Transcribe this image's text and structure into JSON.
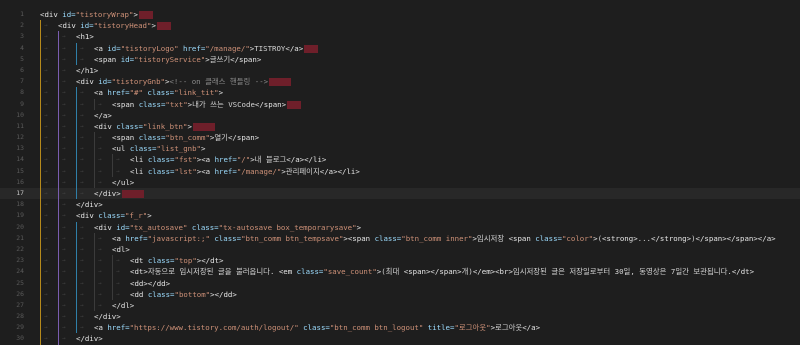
{
  "editor": {
    "lines": [
      {
        "n": "1",
        "indent": 0,
        "code": [
          [
            "tag",
            "<div "
          ],
          [
            "attr",
            "id="
          ],
          [
            "str",
            "\"tistoryWrap\""
          ],
          [
            "tag",
            ">"
          ]
        ],
        "trail": "short"
      },
      {
        "n": "2",
        "indent": 1,
        "code": [
          [
            "tag",
            "<div "
          ],
          [
            "attr",
            "id="
          ],
          [
            "str",
            "\"tistoryHead\""
          ],
          [
            "tag",
            ">"
          ]
        ],
        "trail": "short"
      },
      {
        "n": "3",
        "indent": 2,
        "code": [
          [
            "tag",
            "<h1>"
          ]
        ],
        "trail": ""
      },
      {
        "n": "4",
        "indent": 3,
        "code": [
          [
            "tag",
            "<a "
          ],
          [
            "attr",
            "id="
          ],
          [
            "str",
            "\"tistoryLogo\""
          ],
          [
            "attr",
            " href="
          ],
          [
            "str",
            "\"/manage/\""
          ],
          [
            "tag",
            ">"
          ],
          [
            "txt",
            "TISTROY"
          ],
          [
            "tag",
            "</a>"
          ]
        ],
        "trail": "short"
      },
      {
        "n": "5",
        "indent": 3,
        "code": [
          [
            "tag",
            "<span "
          ],
          [
            "attr",
            "id="
          ],
          [
            "str",
            "\"tistoryService\""
          ],
          [
            "tag",
            ">"
          ],
          [
            "txt",
            "글쓰기"
          ],
          [
            "tag",
            "</span>"
          ]
        ],
        "trail": ""
      },
      {
        "n": "6",
        "indent": 2,
        "code": [
          [
            "tag",
            "</h1>"
          ]
        ],
        "trail": ""
      },
      {
        "n": "7",
        "indent": 2,
        "code": [
          [
            "tag",
            "<div "
          ],
          [
            "attr",
            "id="
          ],
          [
            "str",
            "\"tistoryGnb\""
          ],
          [
            "tag",
            ">"
          ],
          [
            "cmt",
            "<!-- on 클래스 핸들링 -->"
          ]
        ],
        "trail": "long"
      },
      {
        "n": "8",
        "indent": 3,
        "code": [
          [
            "tag",
            "<a "
          ],
          [
            "attr",
            "href="
          ],
          [
            "str",
            "\"#\""
          ],
          [
            "attr",
            " class="
          ],
          [
            "str",
            "\"link_tit\""
          ],
          [
            "tag",
            ">"
          ]
        ],
        "trail": ""
      },
      {
        "n": "9",
        "indent": 4,
        "code": [
          [
            "tag",
            "<span "
          ],
          [
            "attr",
            "class="
          ],
          [
            "str",
            "\"txt\""
          ],
          [
            "tag",
            ">"
          ],
          [
            "txt",
            "내가 쓰는 VSCode"
          ],
          [
            "tag",
            "</span>"
          ]
        ],
        "trail": "short"
      },
      {
        "n": "10",
        "indent": 3,
        "code": [
          [
            "tag",
            "</a>"
          ]
        ],
        "trail": ""
      },
      {
        "n": "11",
        "indent": 3,
        "code": [
          [
            "tag",
            "<div "
          ],
          [
            "attr",
            "class="
          ],
          [
            "str",
            "\"link_btn\""
          ],
          [
            "tag",
            ">"
          ]
        ],
        "trail": "long"
      },
      {
        "n": "12",
        "indent": 4,
        "code": [
          [
            "tag",
            "<span "
          ],
          [
            "attr",
            "class="
          ],
          [
            "str",
            "\"btn_comm\""
          ],
          [
            "tag",
            ">"
          ],
          [
            "txt",
            "열기"
          ],
          [
            "tag",
            "</span>"
          ]
        ],
        "trail": ""
      },
      {
        "n": "13",
        "indent": 4,
        "code": [
          [
            "tag",
            "<ul "
          ],
          [
            "attr",
            "class="
          ],
          [
            "str",
            "\"list_gnb\""
          ],
          [
            "tag",
            ">"
          ]
        ],
        "trail": ""
      },
      {
        "n": "14",
        "indent": 5,
        "code": [
          [
            "tag",
            "<li "
          ],
          [
            "attr",
            "class="
          ],
          [
            "str",
            "\"fst\""
          ],
          [
            "tag",
            ">"
          ],
          [
            "tag",
            "<a "
          ],
          [
            "attr",
            "href="
          ],
          [
            "str",
            "\"/\""
          ],
          [
            "tag",
            ">"
          ],
          [
            "txt",
            "내 블로그"
          ],
          [
            "tag",
            "</a></li>"
          ]
        ],
        "trail": ""
      },
      {
        "n": "15",
        "indent": 5,
        "code": [
          [
            "tag",
            "<li "
          ],
          [
            "attr",
            "class="
          ],
          [
            "str",
            "\"lst\""
          ],
          [
            "tag",
            ">"
          ],
          [
            "tag",
            "<a "
          ],
          [
            "attr",
            "href="
          ],
          [
            "str",
            "\"/manage/\""
          ],
          [
            "tag",
            ">"
          ],
          [
            "txt",
            "관리페이지"
          ],
          [
            "tag",
            "</a></li>"
          ]
        ],
        "trail": ""
      },
      {
        "n": "16",
        "indent": 4,
        "code": [
          [
            "tag",
            "</ul>"
          ]
        ],
        "trail": ""
      },
      {
        "n": "17",
        "indent": 3,
        "code": [
          [
            "tag",
            "</div>"
          ]
        ],
        "trail": "long"
      },
      {
        "n": "18",
        "indent": 2,
        "code": [
          [
            "tag",
            "</div>"
          ]
        ],
        "trail": ""
      },
      {
        "n": "19",
        "indent": 2,
        "code": [
          [
            "tag",
            "<div "
          ],
          [
            "attr",
            "class="
          ],
          [
            "str",
            "\"f_r\""
          ],
          [
            "tag",
            ">"
          ]
        ],
        "trail": ""
      },
      {
        "n": "20",
        "indent": 3,
        "code": [
          [
            "tag",
            "<div "
          ],
          [
            "attr",
            "id="
          ],
          [
            "str",
            "\"tx_autosave\""
          ],
          [
            "attr",
            " class="
          ],
          [
            "str",
            "\"tx-autosave box_temporarysave\""
          ],
          [
            "tag",
            ">"
          ]
        ],
        "trail": ""
      },
      {
        "n": "21",
        "indent": 4,
        "code": [
          [
            "tag",
            "<a "
          ],
          [
            "attr",
            "href="
          ],
          [
            "str",
            "\"javascript:;\""
          ],
          [
            "attr",
            " class="
          ],
          [
            "str",
            "\"btn_comm btn_tempsave\""
          ],
          [
            "tag",
            "><span "
          ],
          [
            "attr",
            "class="
          ],
          [
            "str",
            "\"btn_comm inner\""
          ],
          [
            "tag",
            ">"
          ],
          [
            "txt",
            "임시저장 "
          ],
          [
            "tag",
            "<span "
          ],
          [
            "attr",
            "class="
          ],
          [
            "str",
            "\"color\""
          ],
          [
            "tag",
            ">"
          ],
          [
            "txt",
            "("
          ],
          [
            "tag",
            "<strong>"
          ],
          [
            "txt",
            "..."
          ],
          [
            "tag",
            "</strong>"
          ],
          [
            "txt",
            ")"
          ],
          [
            "tag",
            "</span></span></a>"
          ]
        ],
        "trail": ""
      },
      {
        "n": "22",
        "indent": 4,
        "code": [
          [
            "tag",
            "<dl>"
          ]
        ],
        "trail": ""
      },
      {
        "n": "23",
        "indent": 5,
        "code": [
          [
            "tag",
            "<dt "
          ],
          [
            "attr",
            "class="
          ],
          [
            "str",
            "\"top\""
          ],
          [
            "tag",
            "></dt>"
          ]
        ],
        "trail": ""
      },
      {
        "n": "24",
        "indent": 5,
        "code": [
          [
            "tag",
            "<dt>"
          ],
          [
            "txt",
            "자동으로 임시저장된 글을 불러옵니다. "
          ],
          [
            "tag",
            "<em "
          ],
          [
            "attr",
            "class="
          ],
          [
            "str",
            "\"save_count\""
          ],
          [
            "tag",
            ">"
          ],
          [
            "txt",
            "(최대 "
          ],
          [
            "tag",
            "<span></span>"
          ],
          [
            "txt",
            "개)"
          ],
          [
            "tag",
            "</em><br>"
          ],
          [
            "txt",
            "임시저장된 글은 저장일로부터 30일, 동영상은 7일간 보관됩니다."
          ],
          [
            "tag",
            "</dt>"
          ]
        ],
        "trail": ""
      },
      {
        "n": "25",
        "indent": 5,
        "code": [
          [
            "tag",
            "<dd></dd>"
          ]
        ],
        "trail": ""
      },
      {
        "n": "26",
        "indent": 5,
        "code": [
          [
            "tag",
            "<dd "
          ],
          [
            "attr",
            "class="
          ],
          [
            "str",
            "\"bottom\""
          ],
          [
            "tag",
            "></dd>"
          ]
        ],
        "trail": ""
      },
      {
        "n": "27",
        "indent": 4,
        "code": [
          [
            "tag",
            "</dl>"
          ]
        ],
        "trail": ""
      },
      {
        "n": "28",
        "indent": 3,
        "code": [
          [
            "tag",
            "</div>"
          ]
        ],
        "trail": ""
      },
      {
        "n": "29",
        "indent": 3,
        "code": [
          [
            "tag",
            "<a "
          ],
          [
            "attr",
            "href="
          ],
          [
            "str",
            "\"https://www.tistory.com/auth/logout/\""
          ],
          [
            "attr",
            " class="
          ],
          [
            "str",
            "\"btn_comm btn_logout\""
          ],
          [
            "attr",
            " title="
          ],
          [
            "str",
            "\"로그아웃\""
          ],
          [
            "tag",
            ">"
          ],
          [
            "txt",
            "로그아웃"
          ],
          [
            "tag",
            "</a>"
          ]
        ],
        "trail": ""
      },
      {
        "n": "30",
        "indent": 2,
        "code": [
          [
            "tag",
            "</div>"
          ]
        ],
        "trail": ""
      }
    ],
    "current_line": "17"
  }
}
